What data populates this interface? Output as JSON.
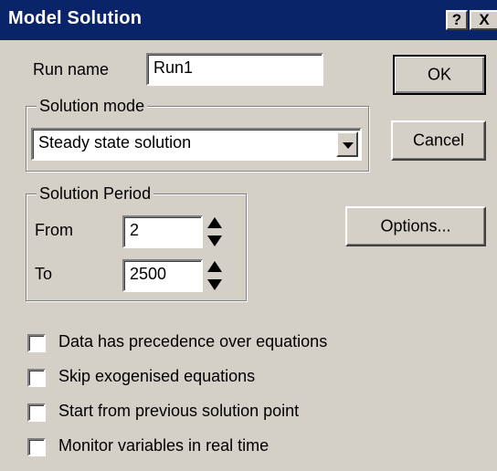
{
  "window": {
    "title": "Model Solution",
    "help_label": "?",
    "close_label": "X"
  },
  "run_name": {
    "label": "Run name",
    "value": "Run1"
  },
  "buttons": {
    "ok": "OK",
    "cancel": "Cancel",
    "options": "Options..."
  },
  "solution_mode": {
    "group_label": "Solution mode",
    "selected": "Steady state solution"
  },
  "solution_period": {
    "group_label": "Solution Period",
    "from_label": "From",
    "from_value": "2",
    "to_label": "To",
    "to_value": "2500"
  },
  "checkboxes": [
    {
      "label": "Data has precedence over equations",
      "checked": false
    },
    {
      "label": "Skip exogenised equations",
      "checked": false
    },
    {
      "label": "Start from previous solution point",
      "checked": false
    },
    {
      "label": "Monitor variables in real time",
      "checked": false
    }
  ],
  "colors": {
    "title_bar": "#0a246a",
    "face": "#d4d0c8"
  }
}
